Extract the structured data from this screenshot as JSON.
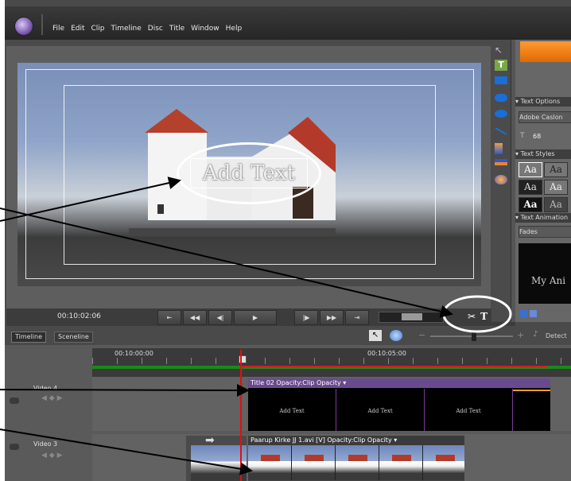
{
  "menu": {
    "items": [
      "File",
      "Edit",
      "Clip",
      "Timeline",
      "Disc",
      "Title",
      "Window",
      "Help"
    ]
  },
  "monitor": {
    "text_overlay": "Add Text",
    "timecode": "00:10:02:06"
  },
  "panel": {
    "text_options_label": "Text Options",
    "font_value": "Adobe Caslon",
    "font_size": "68",
    "text_styles_label": "Text Styles",
    "style_sample": "Aa",
    "text_animation_label": "Text Animation",
    "animation_value": "Fades",
    "preview_text": "My Ani"
  },
  "timeline": {
    "tab_timeline": "Timeline",
    "tab_sceneline": "Sceneline",
    "detect_label": "Detect",
    "time_start": "00:10:00:00",
    "time_mid": "00:10:05:00",
    "tracks": [
      {
        "name": "Video 4",
        "clip_header": "Title 02  Opacity:Clip Opacity ▾",
        "frame_text": "Add Text"
      },
      {
        "name": "Video 3",
        "clip_header": "Paarup Kirke JJ 1.avi [V]  Opacity:Clip Opacity ▾"
      }
    ]
  },
  "colors": {
    "accent_orange": "#f07a10",
    "title_clip": "#6a4a8e",
    "playhead": "#e01010",
    "annotation": "#ffffff"
  }
}
